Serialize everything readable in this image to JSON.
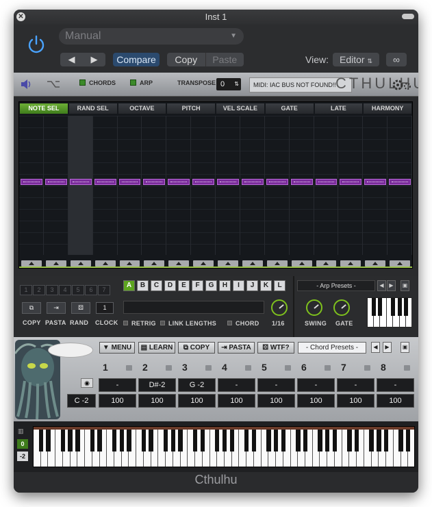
{
  "window": {
    "title": "Inst 1"
  },
  "host": {
    "preset": "Manual",
    "compare": "Compare",
    "copy": "Copy",
    "paste": "Paste",
    "view_label": "View:",
    "view_value": "Editor",
    "prev": "◀",
    "next": "▶"
  },
  "toolbar": {
    "chords": "CHORDS",
    "arp": "ARP",
    "transpose_label": "TRANSPOSE",
    "transpose_value": "0",
    "midi_status": "MIDI: IAC BUS NOT FOUND!!",
    "logo": "CTHULHU"
  },
  "grid": {
    "columns": [
      "NOTE SEL",
      "RAND SEL",
      "OCTAVE",
      "PITCH",
      "VEL SCALE",
      "GATE",
      "LATE",
      "HARMONY"
    ],
    "active_column": "NOTE SEL"
  },
  "pattern": {
    "steps": [
      "1",
      "2",
      "3",
      "4",
      "5",
      "6",
      "7"
    ],
    "copy": "COPY",
    "pasta": "PASTA",
    "rand": "RAND",
    "clock_label": "CLOCK",
    "clock_value": "1",
    "letters": [
      "A",
      "B",
      "C",
      "D",
      "E",
      "F",
      "G",
      "H",
      "I",
      "J",
      "K",
      "L"
    ],
    "active_letter": "A",
    "retrig": "RETRIG",
    "link_lengths": "LINK LENGTHS",
    "chord": "CHORD",
    "rate": "1/16"
  },
  "arp": {
    "presets": "- Arp Presets -",
    "swing": "SWING",
    "gate": "GATE"
  },
  "chordsec": {
    "menu": "MENU",
    "learn": "LEARN",
    "copy": "COPY",
    "pasta": "PASTA",
    "wtf": "WTF?",
    "presets": "- Chord Presets -",
    "root": "C -2",
    "slots": [
      {
        "num": "1",
        "note": "-",
        "vel": "100"
      },
      {
        "num": "2",
        "note": "D#-2",
        "vel": "100"
      },
      {
        "num": "3",
        "note": "G -2",
        "vel": "100"
      },
      {
        "num": "4",
        "note": "-",
        "vel": "100"
      },
      {
        "num": "5",
        "note": "-",
        "vel": "100"
      },
      {
        "num": "6",
        "note": "-",
        "vel": "100"
      },
      {
        "num": "7",
        "note": "-",
        "vel": "100"
      },
      {
        "num": "8",
        "note": "-",
        "vel": "100"
      }
    ]
  },
  "keyboard": {
    "octave_up": "0",
    "octave_down": "-2"
  },
  "footer": {
    "name": "Cthulhu"
  },
  "colors": {
    "accent_green": "#5da51f",
    "purple": "#7b2d9c",
    "host_blue": "#2b4a6e"
  }
}
